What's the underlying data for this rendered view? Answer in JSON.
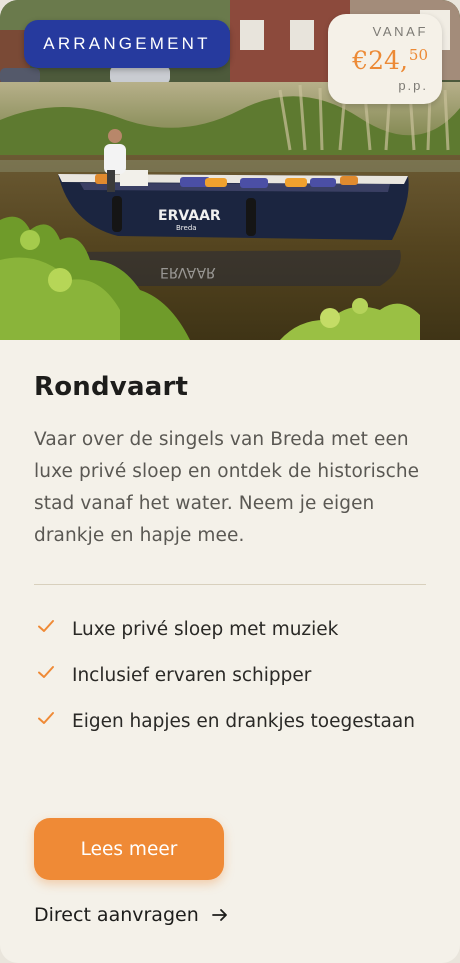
{
  "hero": {
    "badge_label": "ARRANGEMENT",
    "price": {
      "prefix": "VANAF",
      "amount": "€24,",
      "cents": "50",
      "unit": "p.p."
    },
    "boat_name": "ERVAAR",
    "boat_subname": "Breda"
  },
  "card": {
    "title": "Rondvaart",
    "description": "Vaar over de singels van Breda met een luxe privé sloep en ontdek de historische stad vanaf het water. Neem je eigen drankje en hapje mee.",
    "features": [
      "Luxe privé sloep met muziek",
      "Inclusief ervaren schipper",
      "Eigen hapjes en drankjes toegestaan"
    ],
    "primary_button": "Lees meer",
    "secondary_link": "Direct aanvragen"
  },
  "colors": {
    "accent": "#ef8a36",
    "badge_blue": "#263a9e",
    "card_bg": "#f4f1e9",
    "text_dark": "#1d1d1b",
    "text_muted": "#5a5853"
  },
  "icons": {
    "feature_icon": "check-icon",
    "link_icon": "arrow-right-icon"
  }
}
